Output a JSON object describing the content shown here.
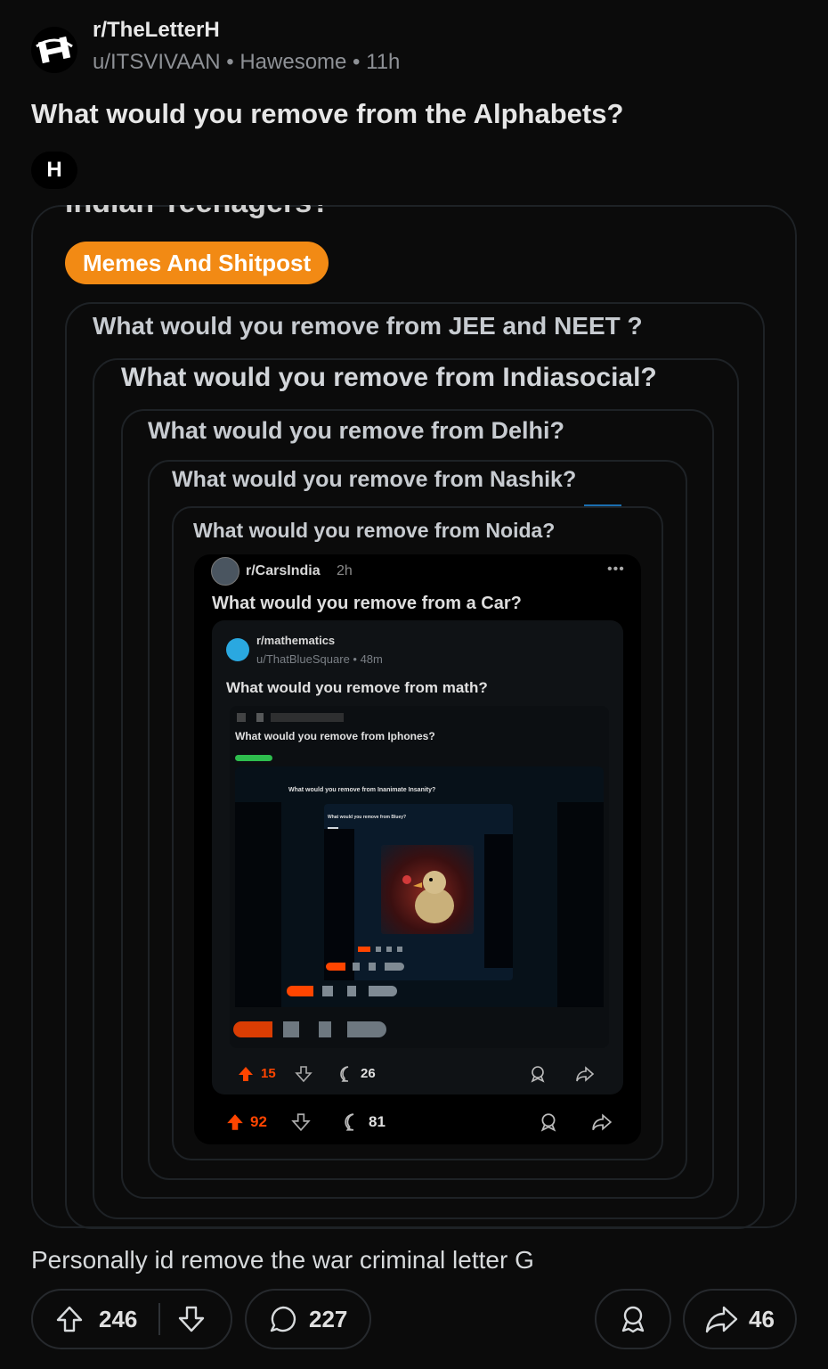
{
  "header": {
    "subreddit": "r/TheLetterH",
    "meta": "u/ITSVIVAAN • Hawesome • 11h"
  },
  "post": {
    "title": "What would you remove from the Alphabets?",
    "flair": "H",
    "body": "Personally id remove the war criminal letter G"
  },
  "nested": {
    "cut_title": "Indian Teenagers?",
    "flair": "Memes And Shitpost",
    "titles": [
      "What would you remove from JEE and NEET ?",
      "What would you remove from Indiasocial?",
      "What would you remove from Delhi?",
      "What would you remove from Nashik?",
      "What would you remove from Noida?"
    ],
    "cars": {
      "sub": "r/CarsIndia",
      "time": "2h",
      "title": "What would you remove from a Car?",
      "votes": "92",
      "comments": "81"
    },
    "math": {
      "sub": "r/mathematics",
      "meta": "u/ThatBlueSquare • 48m",
      "title": "What would you remove from math?",
      "votes": "15",
      "comments": "26"
    },
    "iphone": {
      "title": "What would you remove from Iphones?"
    },
    "inanimate": {
      "title": "What would you remove from Inanimate Insanity?"
    },
    "bluey": {
      "title": "What would you remove from Bluey?"
    }
  },
  "actions": {
    "votes": "246",
    "comments": "227",
    "shares": "46"
  },
  "colors": {
    "accent": "#f28a14",
    "upvote": "#ff4500",
    "background": "#0b0b0b"
  }
}
